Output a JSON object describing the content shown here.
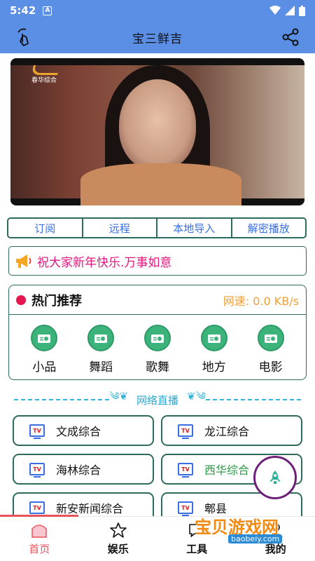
{
  "status_bar": {
    "time": "5:42",
    "notif_badge": "A"
  },
  "header": {
    "title": "宝三鲜吉"
  },
  "video": {
    "logo_text": "春华综合"
  },
  "tabs": [
    {
      "label": "订阅"
    },
    {
      "label": "远程"
    },
    {
      "label": "本地导入"
    },
    {
      "label": "解密播放"
    }
  ],
  "notice": {
    "text": "祝大家新年快乐.万事如意"
  },
  "hot": {
    "title": "热门推荐",
    "speed": "网速: 0.0 KB/s",
    "categories": [
      {
        "label": "小品"
      },
      {
        "label": "舞蹈"
      },
      {
        "label": "歌舞"
      },
      {
        "label": "地方"
      },
      {
        "label": "电影"
      }
    ]
  },
  "divider": {
    "label": "网络直播"
  },
  "channels": [
    {
      "name": "文成综合",
      "badge": "TV"
    },
    {
      "name": "龙江综合",
      "badge": "TV"
    },
    {
      "name": "海林综合",
      "badge": "TV"
    },
    {
      "name": "西华综合",
      "badge": "TV"
    },
    {
      "name": "新安新闻综合",
      "badge": "TV"
    },
    {
      "name": "郫县",
      "badge": "TV"
    }
  ],
  "bottom_nav": [
    {
      "label": "首页",
      "active": true
    },
    {
      "label": "娱乐",
      "active": false
    },
    {
      "label": "工具",
      "active": false
    },
    {
      "label": "我的",
      "active": false
    }
  ],
  "watermark": {
    "title": "宝贝游戏网",
    "url": "baobeiy.com"
  },
  "colors": {
    "primary": "#5b8fe6",
    "accent_pink": "#e3157e",
    "border_green": "#2e6a5d",
    "nav_active": "#e8525b",
    "speed_orange": "#f0a03a"
  }
}
